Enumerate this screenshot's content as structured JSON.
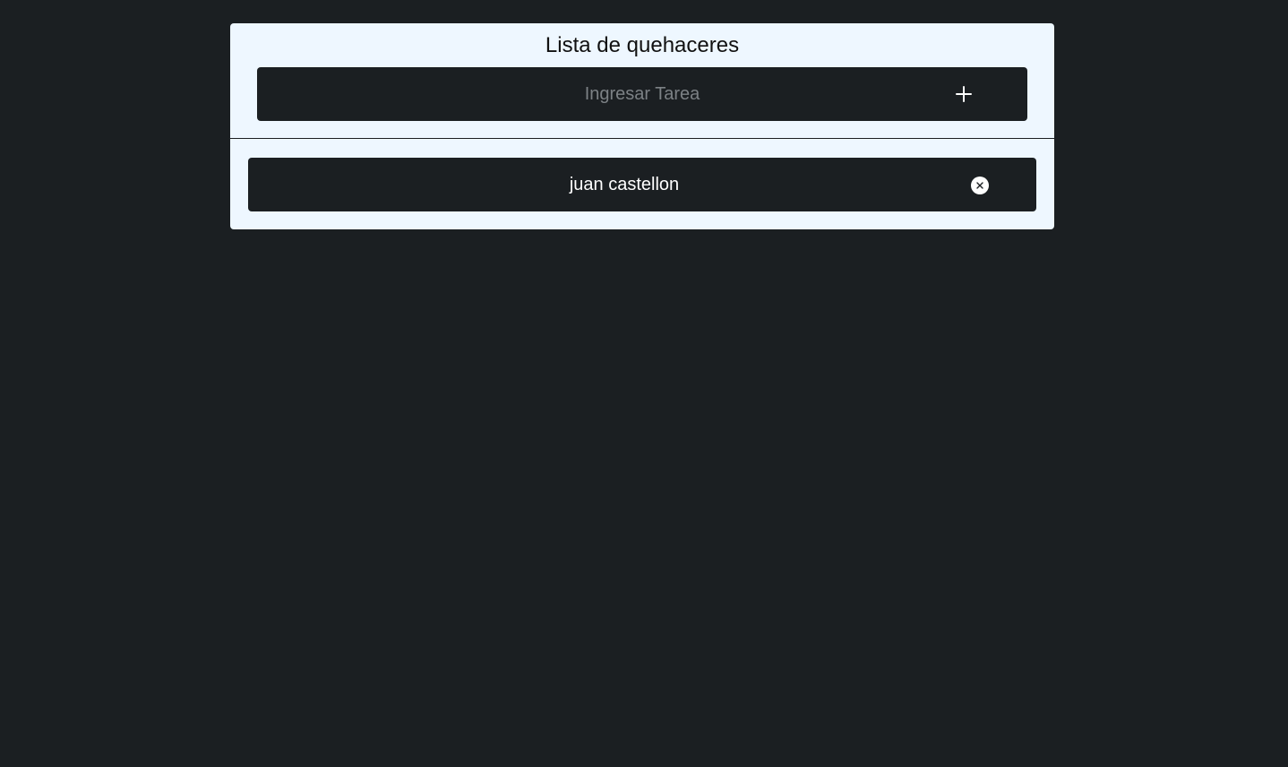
{
  "app": {
    "title": "Lista de quehaceres"
  },
  "form": {
    "input_placeholder": "Ingresar Tarea",
    "input_value": "",
    "add_icon": "plus-icon"
  },
  "tasks": [
    {
      "text": "juan castellon",
      "delete_icon": "circle-x-icon"
    }
  ],
  "colors": {
    "background": "#1b1f22",
    "card": "#eef7ff",
    "text_light": "#ffffff",
    "placeholder": "#7c8185"
  }
}
